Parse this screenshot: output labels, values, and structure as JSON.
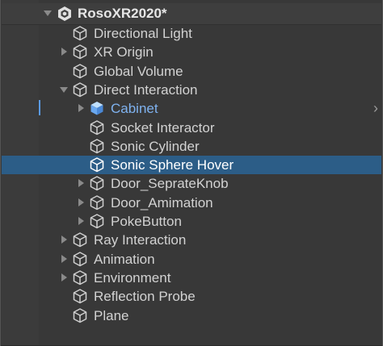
{
  "hierarchy": {
    "root": {
      "label": "RosoXR2020*",
      "icon": "unity-scene-icon",
      "expanded": true
    },
    "items": [
      {
        "label": "Directional Light",
        "icon": "gameobject-cube-icon",
        "arrow": "none",
        "state": "normal"
      },
      {
        "label": "XR Origin",
        "icon": "gameobject-cube-icon",
        "arrow": "right",
        "state": "normal"
      },
      {
        "label": "Global Volume",
        "icon": "gameobject-cube-icon",
        "arrow": "none",
        "state": "normal"
      },
      {
        "label": "Direct Interaction",
        "icon": "gameobject-cube-icon",
        "arrow": "down",
        "state": "normal"
      },
      {
        "label": "Cabinet",
        "icon": "prefab-cube-icon",
        "arrow": "right",
        "state": "prefab"
      },
      {
        "label": "Socket Interactor",
        "icon": "gameobject-cube-icon",
        "arrow": "none",
        "state": "normal"
      },
      {
        "label": "Sonic Cylinder",
        "icon": "gameobject-cube-icon",
        "arrow": "none",
        "state": "normal"
      },
      {
        "label": "Sonic Sphere Hover",
        "icon": "gameobject-cube-icon",
        "arrow": "none",
        "state": "selected"
      },
      {
        "label": "Door_SeprateKnob",
        "icon": "gameobject-cube-icon",
        "arrow": "right",
        "state": "normal"
      },
      {
        "label": "Door_Amimation",
        "icon": "gameobject-cube-icon",
        "arrow": "right",
        "state": "normal"
      },
      {
        "label": "PokeButton",
        "icon": "gameobject-cube-icon",
        "arrow": "right",
        "state": "normal"
      },
      {
        "label": "Ray Interaction",
        "icon": "gameobject-cube-icon",
        "arrow": "right",
        "state": "normal"
      },
      {
        "label": "Animation",
        "icon": "gameobject-cube-icon",
        "arrow": "right",
        "state": "normal"
      },
      {
        "label": "Environment",
        "icon": "gameobject-cube-icon",
        "arrow": "right",
        "state": "normal"
      },
      {
        "label": "Reflection Probe",
        "icon": "gameobject-cube-icon",
        "arrow": "none",
        "state": "normal"
      },
      {
        "label": "Plane",
        "icon": "gameobject-cube-icon",
        "arrow": "none",
        "state": "normal"
      }
    ]
  },
  "colors": {
    "background": "#383838",
    "selection": "#2c5d87",
    "prefab_text": "#7fb2ef",
    "text": "#d2d2d2"
  }
}
